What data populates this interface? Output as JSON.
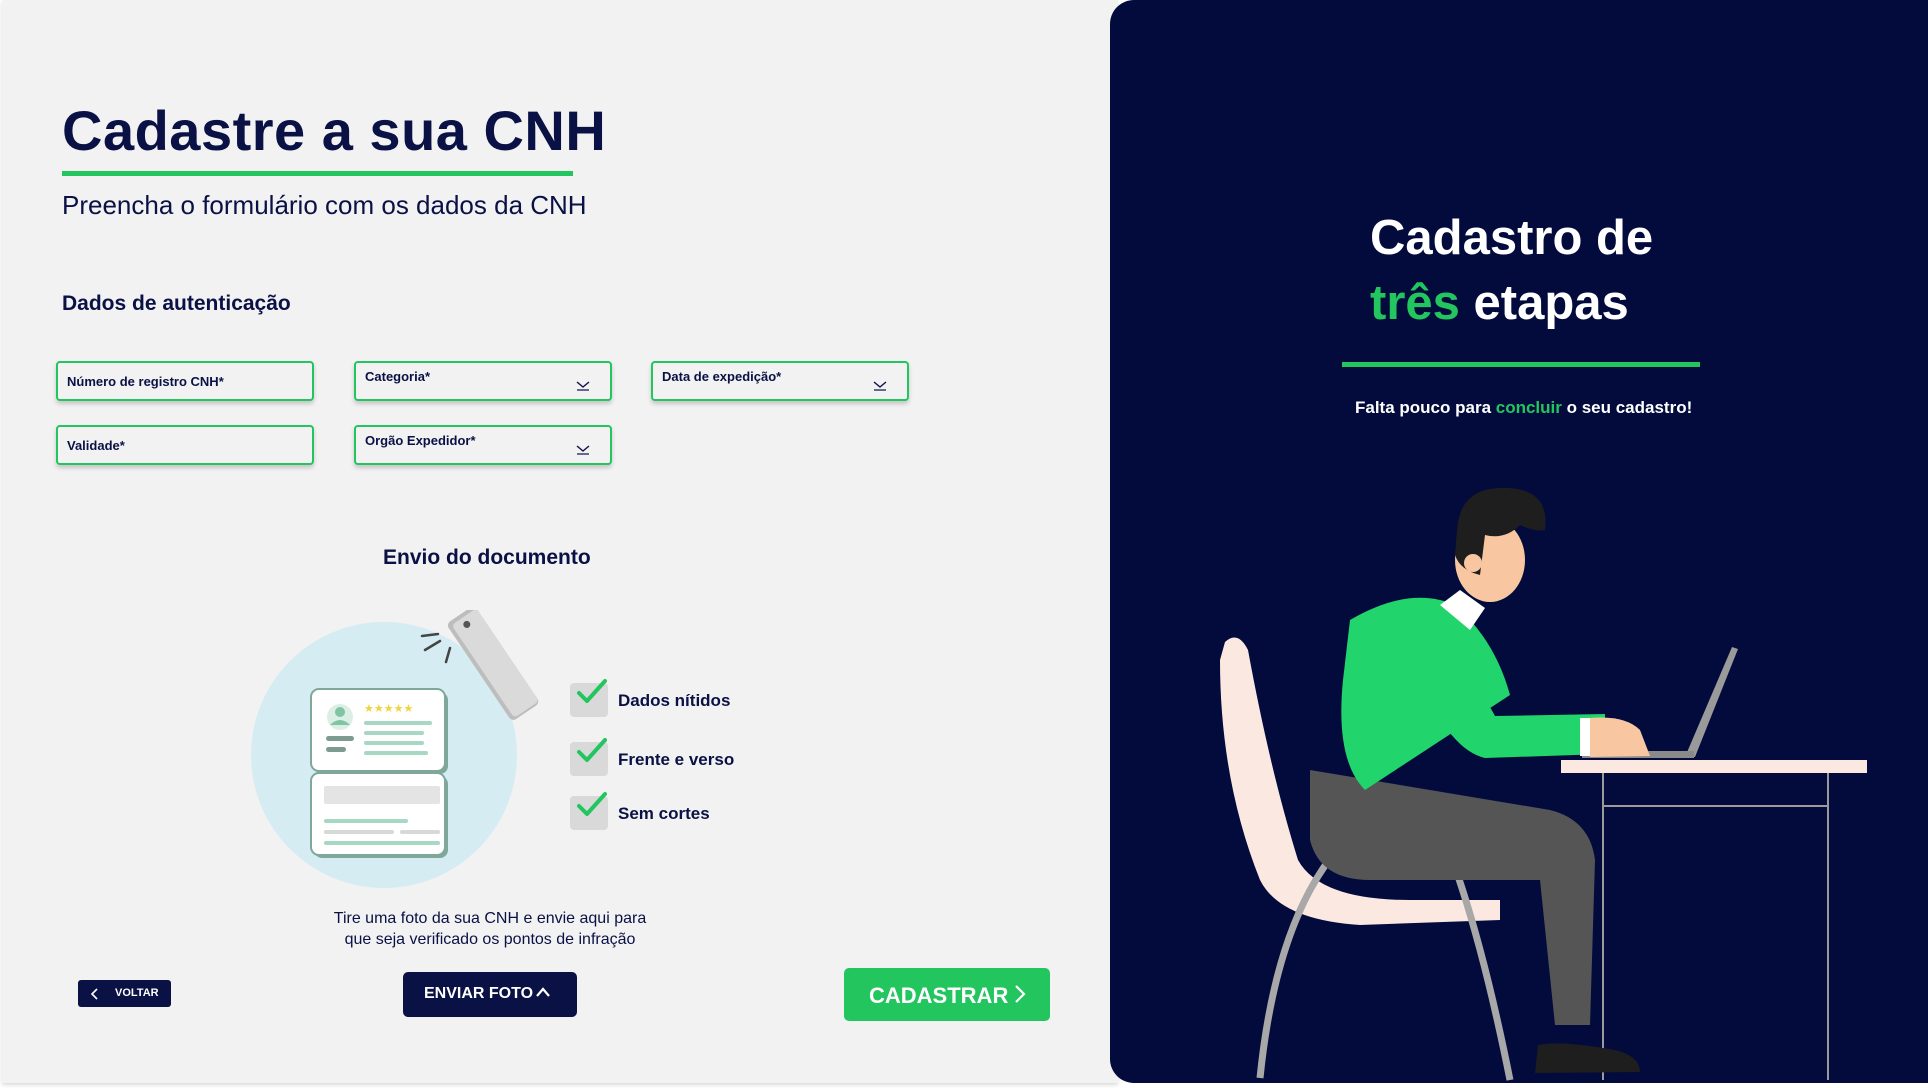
{
  "form": {
    "title": "Cadastre a sua CNH",
    "subtitle": "Preencha o formulário com os dados da CNH",
    "section_title": "Dados de autenticação",
    "fields": {
      "registro": "Número de registro CNH*",
      "categoria": "Categoria*",
      "data_expedicao": "Data de expedição*",
      "validade": "Validade*",
      "orgao": "Orgão Expedidor*"
    }
  },
  "upload": {
    "title": "Envio do documento",
    "checklist": [
      "Dados nítidos",
      "Frente e verso",
      "Sem cortes"
    ],
    "hint_line1": "Tire uma foto da sua CNH e envie aqui para",
    "hint_line2": "que seja verificado os pontos de infração"
  },
  "actions": {
    "back": "VOLTAR",
    "send_photo": "ENVIAR FOTO",
    "submit": "CADASTRAR"
  },
  "promo": {
    "title_line1": "Cadastro de",
    "title_accent": "três",
    "title_rest": " etapas",
    "sub_before": "Falta pouco para ",
    "sub_accent": "concluir",
    "sub_after": " o seu cadastro!"
  },
  "colors": {
    "navy": "#0a1145",
    "panel": "#020b3c",
    "green": "#22c55e",
    "background": "#f2f2f2"
  },
  "icons": [
    "chevron-down-icon",
    "check-icon",
    "chevron-left-icon",
    "chevron-up-icon",
    "chevron-right-icon"
  ]
}
